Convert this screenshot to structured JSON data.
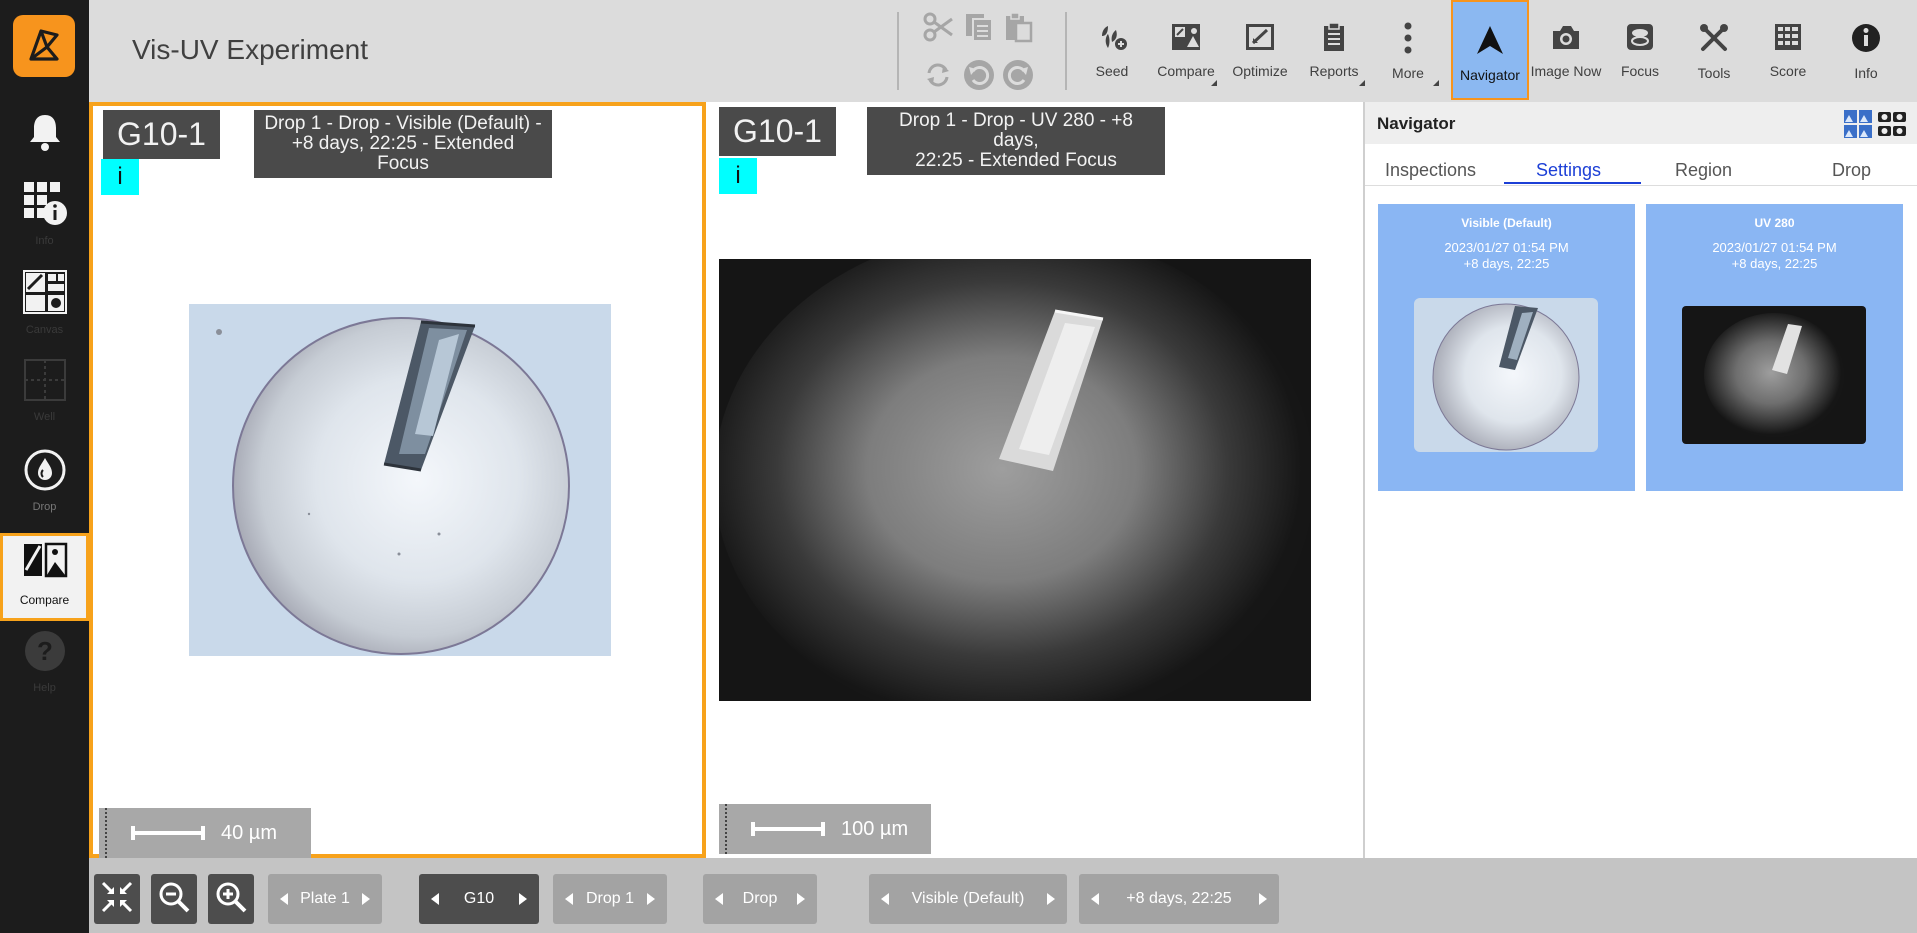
{
  "app": {
    "title": "Vis-UV Experiment"
  },
  "sidebar": {
    "logo_icon": "rock-maker-logo",
    "items": [
      {
        "name": "notifications",
        "label": "",
        "icon": "bell-icon"
      },
      {
        "name": "info",
        "label": "Info",
        "icon": "plate-info-icon"
      },
      {
        "name": "canvas",
        "label": "Canvas",
        "icon": "canvas-icon"
      },
      {
        "name": "well",
        "label": "Well",
        "icon": "well-grid-icon"
      },
      {
        "name": "drop",
        "label": "Drop",
        "icon": "drop-icon"
      },
      {
        "name": "compare",
        "label": "Compare",
        "icon": "compare-icon",
        "active": true
      },
      {
        "name": "help",
        "label": "Help",
        "icon": "help-icon"
      }
    ]
  },
  "toolbar": {
    "edit_icons": [
      "scissors-icon",
      "copy-icon",
      "paste-icon",
      "sync-icon",
      "undo-icon",
      "redo-icon"
    ],
    "buttons": [
      {
        "label": "Seed",
        "icon": "seed-icon"
      },
      {
        "label": "Compare",
        "icon": "compare-images-icon"
      },
      {
        "label": "Optimize",
        "icon": "optimize-icon"
      },
      {
        "label": "Reports",
        "icon": "clipboard-icon"
      },
      {
        "label": "More",
        "icon": "more-vertical-icon"
      },
      {
        "label": "Navigator",
        "icon": "navigation-arrow-icon",
        "active": true
      },
      {
        "label": "Image Now",
        "icon": "camera-icon"
      },
      {
        "label": "Focus",
        "icon": "focus-icon"
      },
      {
        "label": "Tools",
        "icon": "tools-icon"
      },
      {
        "label": "Score",
        "icon": "score-icon"
      },
      {
        "label": "Info",
        "icon": "info-icon"
      }
    ]
  },
  "panes": {
    "left": {
      "well": "G10-1",
      "description_line1": "Drop 1 - Drop - Visible (Default) -",
      "description_line2": "+8 days, 22:25 - Extended Focus",
      "info": "i",
      "scale": "40 µm",
      "image": "visible-crystal-image"
    },
    "right": {
      "well": "G10-1",
      "description_line1": "Drop 1 - Drop - UV 280 - +8 days,",
      "description_line2": "22:25 - Extended Focus",
      "info": "i",
      "scale": "100 µm",
      "image": "uv280-crystal-image"
    }
  },
  "navigator": {
    "title": "Navigator",
    "tabs": [
      "Inspections",
      "Settings",
      "Region",
      "Drop"
    ],
    "active_tab": "Settings",
    "cards": [
      {
        "title": "Visible (Default)",
        "date": "2023/01/27 01:54 PM",
        "time": "+8 days, 22:25"
      },
      {
        "title": "UV 280",
        "date": "2023/01/27 01:54 PM",
        "time": "+8 days, 22:25"
      }
    ]
  },
  "bottombar": {
    "buttons": [
      "fit-icon",
      "zoom-out-icon",
      "zoom-in-icon"
    ],
    "plate": "Plate 1",
    "well": "G10",
    "drop": "Drop 1",
    "region": "Drop",
    "setting": "Visible (Default)",
    "time": "+8 days, 22:25"
  },
  "colors": {
    "accent": "#f7941d",
    "navigator_blue": "#8ab6f3",
    "info_cyan": "#00ffff"
  }
}
